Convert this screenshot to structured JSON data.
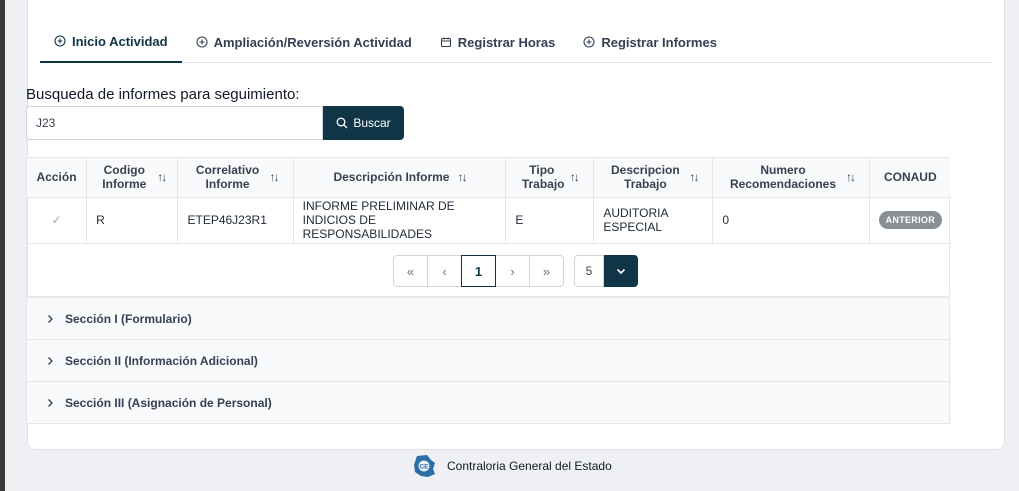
{
  "tabs": [
    {
      "label": "Inicio Actividad",
      "icon": "plus-circle-icon",
      "active": true
    },
    {
      "label": "Ampliación/Reversión Actividad",
      "icon": "plus-circle-icon",
      "active": false
    },
    {
      "label": "Registrar Horas",
      "icon": "calendar-icon",
      "active": false
    },
    {
      "label": "Registrar Informes",
      "icon": "plus-circle-icon",
      "active": false
    }
  ],
  "search": {
    "label": "Busqueda de informes para seguimiento:",
    "value": "J23",
    "button_label": "Buscar"
  },
  "table": {
    "headers": {
      "accion": "Acción",
      "codigo": "Codigo Informe",
      "correlativo": "Correlativo Informe",
      "descripcion": "Descripción Informe",
      "tipo": "Tipo Trabajo",
      "desc_trabajo": "Descripcion Trabajo",
      "numero": "Numero Recomendaciones",
      "conaud": "CONAUD"
    },
    "rows": [
      {
        "accion": "✓",
        "codigo": "R",
        "correlativo": "ETEP46J23R1",
        "descripcion": "INFORME PRELIMINAR DE INDICIOS DE RESPONSABILIDADES",
        "tipo": "E",
        "desc_trabajo": "AUDITORIA ESPECIAL",
        "numero": "0",
        "conaud": "ANTERIOR"
      }
    ]
  },
  "pagination": {
    "first": "«",
    "prev": "‹",
    "current": "1",
    "next": "›",
    "last": "»",
    "page_size": "5"
  },
  "sections": [
    {
      "label": "Sección I (Formulario)"
    },
    {
      "label": "Sección II (Información Adicional)"
    },
    {
      "label": "Sección III (Asignación de Personal)"
    }
  ],
  "footer": {
    "text": "Contraloria General del Estado"
  },
  "colors": {
    "primary": "#0f3547",
    "badge": "#8a8f94"
  }
}
